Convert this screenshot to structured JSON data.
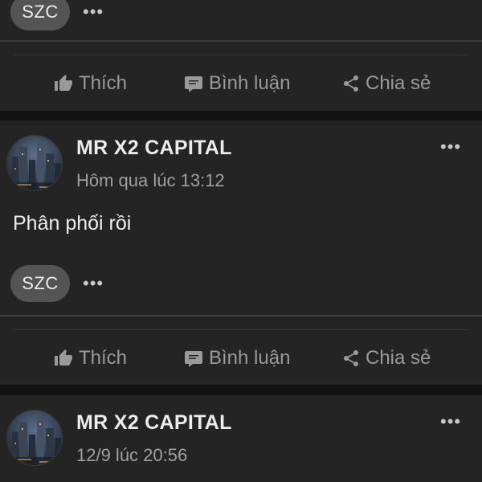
{
  "top_card": {
    "tag": "SZC",
    "more": "•••",
    "actions": {
      "like": "Thích",
      "comment": "Bình luận",
      "share": "Chia sẻ"
    }
  },
  "posts": [
    {
      "author": "MR X2 CAPITAL",
      "timestamp": "Hôm qua lúc 13:12",
      "text": "Phân phối rồi",
      "tag": "SZC",
      "more": "•••",
      "actions": {
        "like": "Thích",
        "comment": "Bình luận",
        "share": "Chia sẻ"
      }
    },
    {
      "author": "MR X2 CAPITAL",
      "timestamp": "12/9 lúc 20:56",
      "more": "•••"
    }
  ],
  "icons": {
    "like": "thumbs-up-icon",
    "comment": "comment-icon",
    "share": "share-icon",
    "more": "more-options-icon"
  },
  "colors": {
    "background": "#121212",
    "card": "#242424",
    "chip": "#545454",
    "action_text": "#9a9a9a",
    "primary_text": "#ececec",
    "secondary_text": "#a0a0a0"
  }
}
